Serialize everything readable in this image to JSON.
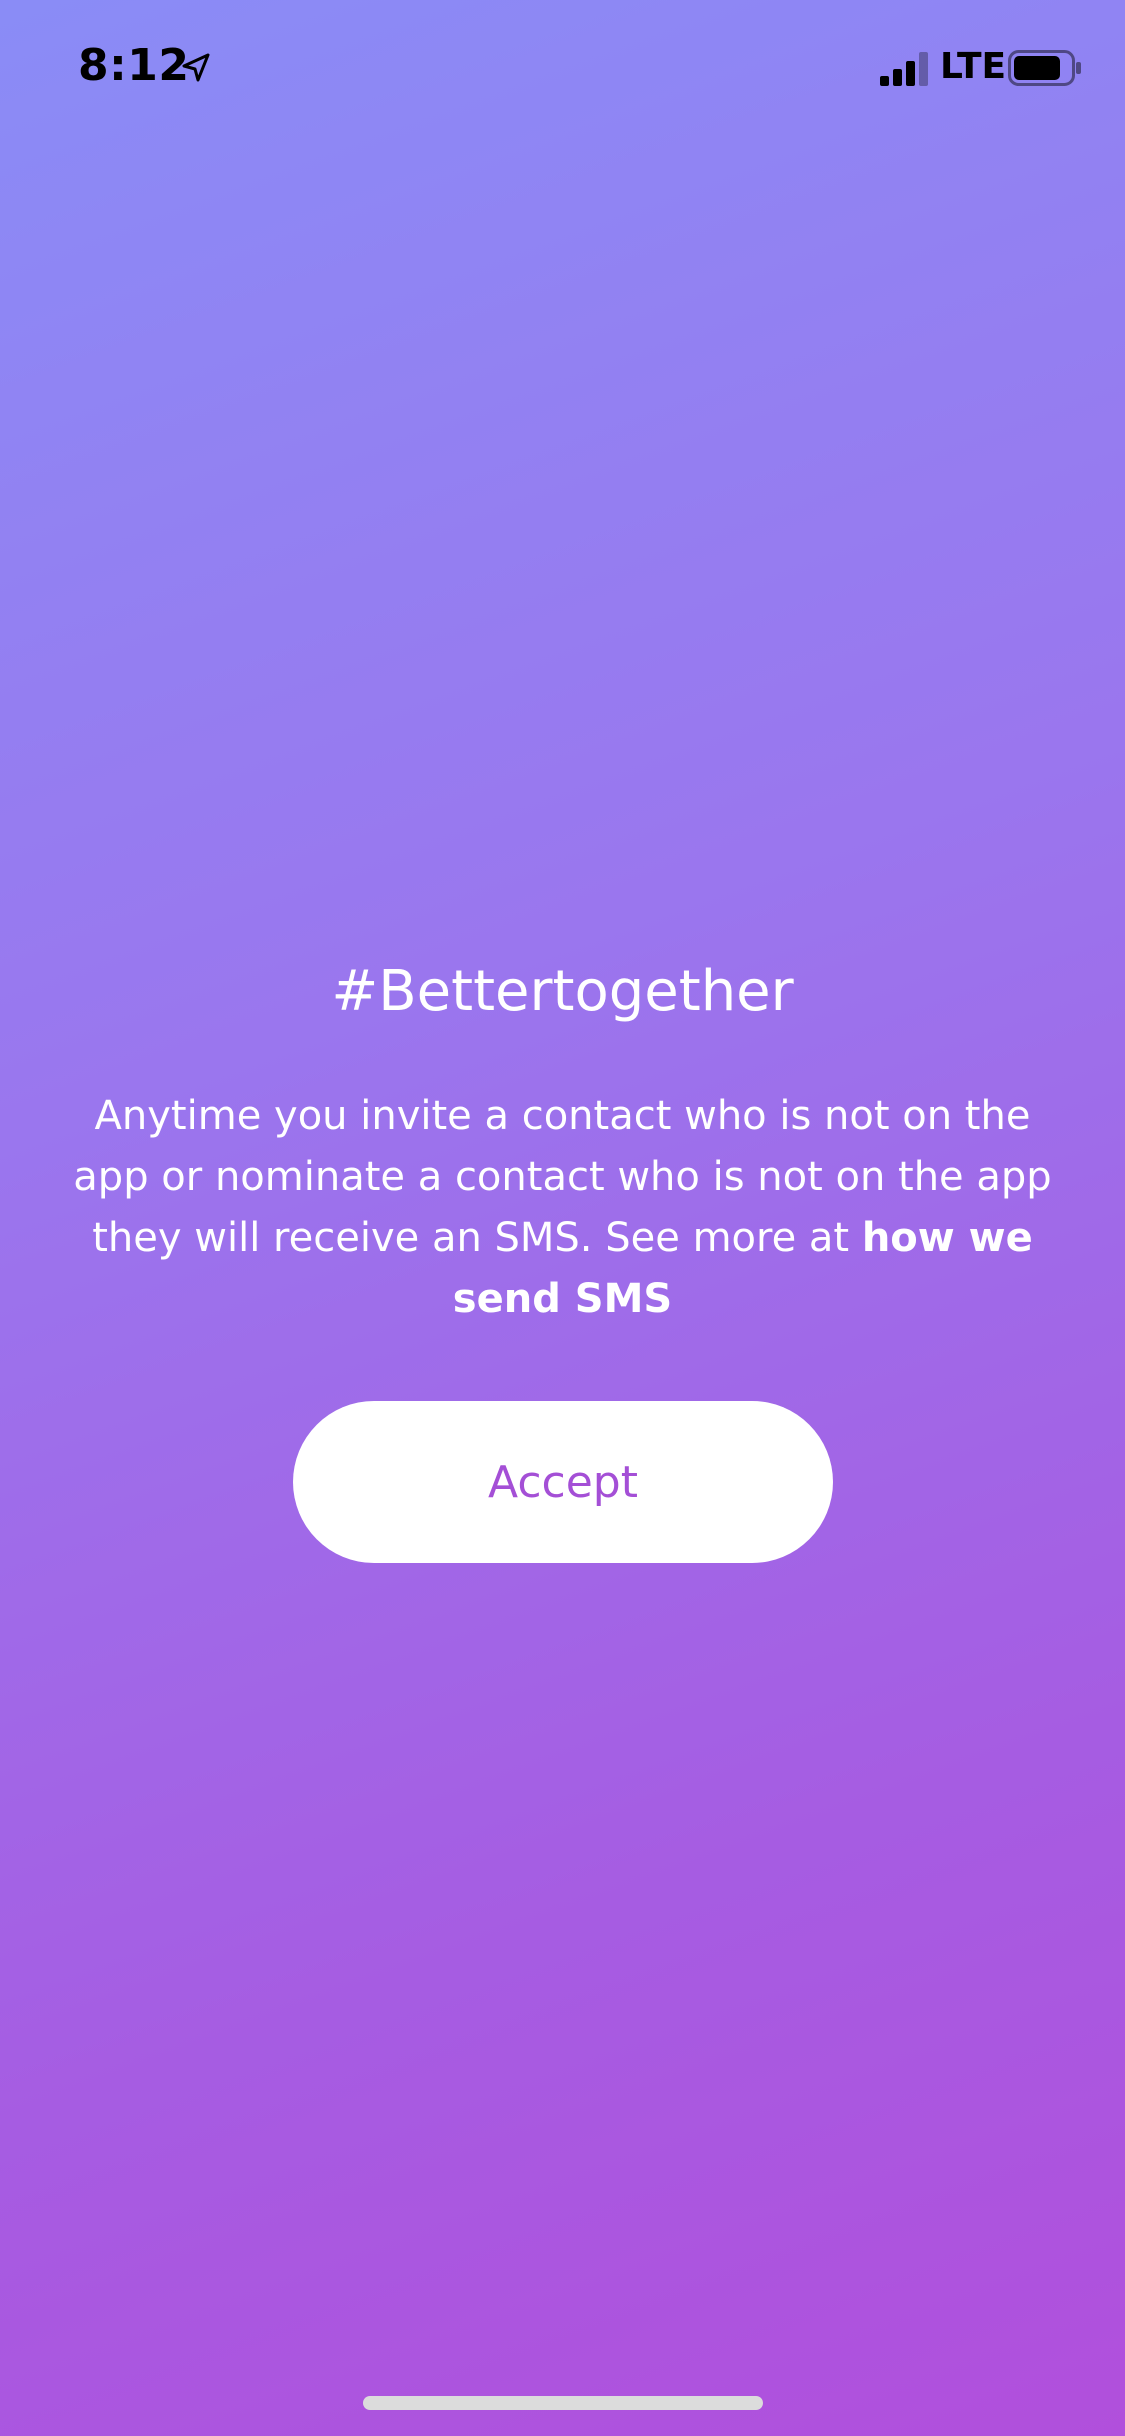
{
  "status_bar": {
    "time": "8:12",
    "network": "LTE",
    "signal_bars_filled": 3,
    "signal_bars_total": 4,
    "battery_level": 0.8,
    "icons": [
      "location-arrow-icon",
      "signal-icon",
      "battery-icon"
    ]
  },
  "content": {
    "title": "#Bettertogether",
    "body": "Anytime you invite a contact who is not on the app or nominate a contact who is not on the app they will receive an SMS. See more at ",
    "link": "how we send SMS",
    "accept_label": "Accept"
  },
  "colors": {
    "gradient_start": "#8a8cf6",
    "gradient_end": "#b14fdc",
    "button_text": "#a44fd6",
    "button_bg": "#ffffff"
  }
}
